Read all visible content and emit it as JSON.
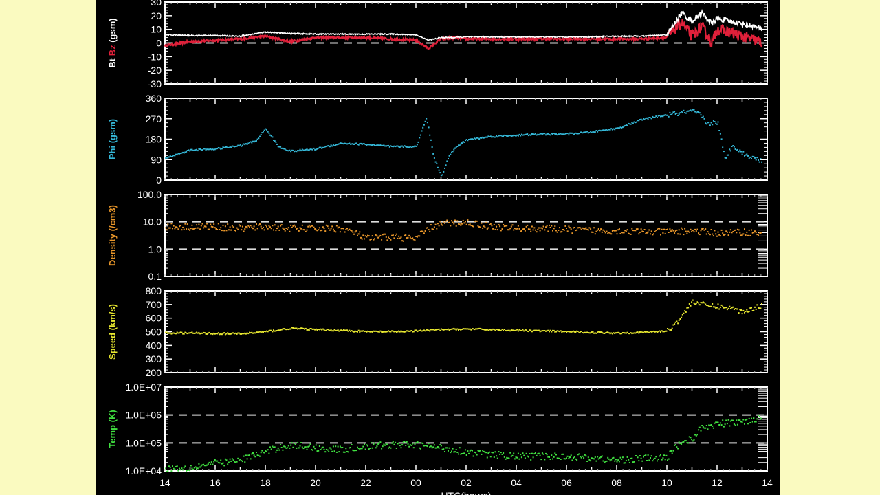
{
  "colors": {
    "page_bg": "#fafac0",
    "panel_bg": "#000000",
    "bt": "#ffffff",
    "bz": "#e0203a",
    "phi": "#35b8d8",
    "density": "#e8962a",
    "speed": "#e8e830",
    "temp": "#40e040"
  },
  "chart_data": [
    {
      "type": "line",
      "ylabel_parts": [
        "Bt",
        "Bz",
        "(gsm)"
      ],
      "ylim": [
        -30,
        30
      ],
      "yticks": [
        "-30",
        "-20",
        "-10",
        "0",
        "10",
        "20",
        "30"
      ],
      "reference_line": 0,
      "x": [
        14,
        15,
        16,
        17,
        18,
        19,
        20,
        21,
        22,
        23,
        24,
        24.5,
        25,
        25.5,
        26,
        27,
        28,
        29,
        30,
        31,
        32,
        33,
        34,
        34.3,
        34.6,
        35,
        35.4,
        35.8,
        36,
        36.5,
        37,
        37.5,
        37.8
      ],
      "series": [
        {
          "name": "Bt",
          "values": [
            6,
            5.5,
            5.5,
            5,
            8,
            7,
            6.5,
            6.5,
            6.5,
            6.5,
            6,
            2,
            4,
            4,
            4.5,
            4.5,
            4.5,
            4.5,
            4.5,
            4.5,
            5,
            5,
            6,
            14,
            22,
            16,
            22,
            14,
            18,
            16,
            14,
            12,
            10
          ]
        },
        {
          "name": "Bz",
          "values": [
            -2,
            1,
            2,
            3,
            5,
            1,
            4,
            4,
            4,
            3,
            2,
            -4,
            3,
            4,
            3,
            3,
            3,
            3,
            3,
            3,
            3,
            3,
            4,
            10,
            15,
            5,
            12,
            0,
            10,
            8,
            5,
            2,
            0
          ]
        }
      ]
    },
    {
      "type": "scatter",
      "ylabel": "Phi (gsm)",
      "ylim": [
        0,
        360
      ],
      "yticks": [
        "0",
        "90",
        "180",
        "270",
        "360"
      ],
      "x": [
        14,
        15,
        16,
        17,
        17.6,
        18,
        18.5,
        19,
        20,
        21,
        22,
        23,
        24,
        24.4,
        24.7,
        25,
        25.3,
        25.6,
        26,
        27,
        28,
        29,
        30,
        31,
        32,
        33,
        34,
        35,
        35.3,
        35.6,
        36,
        36.3,
        36.6,
        37,
        37.4,
        37.8
      ],
      "series": [
        {
          "name": "Phi",
          "values": [
            100,
            135,
            140,
            155,
            175,
            230,
            150,
            130,
            140,
            165,
            160,
            150,
            150,
            280,
            100,
            20,
            110,
            150,
            180,
            195,
            200,
            205,
            205,
            215,
            230,
            270,
            290,
            305,
            290,
            250,
            260,
            90,
            160,
            120,
            100,
            90
          ]
        }
      ]
    },
    {
      "type": "scatter",
      "ylabel": "Density (/cm3)",
      "yscale": "log",
      "ylim": [
        0.1,
        100
      ],
      "yticks": [
        "0.1",
        "1.0",
        "10.0",
        "100.0"
      ],
      "reference_lines": [
        1,
        10
      ],
      "x": [
        14,
        15,
        16,
        17,
        18,
        19,
        20,
        21,
        22,
        23,
        24,
        25,
        26,
        27,
        28,
        29,
        30,
        31,
        32,
        33,
        34,
        35,
        36,
        37,
        37.8
      ],
      "series": [
        {
          "name": "Density",
          "values": [
            7,
            7,
            7,
            6,
            7,
            6,
            6,
            6,
            2.5,
            3,
            2.5,
            9,
            10,
            7,
            6,
            6,
            5.5,
            5,
            5,
            4.5,
            4.5,
            5,
            4,
            4.5,
            4
          ]
        }
      ]
    },
    {
      "type": "scatter",
      "ylabel": "Speed (km/s)",
      "ylim": [
        200,
        800
      ],
      "yticks": [
        "200",
        "300",
        "400",
        "500",
        "600",
        "700",
        "800"
      ],
      "x": [
        14,
        15,
        16,
        17,
        18,
        19,
        20,
        21,
        22,
        23,
        24,
        25,
        26,
        27,
        28,
        29,
        30,
        31,
        32,
        33,
        34,
        34.5,
        35,
        35.5,
        36,
        36.5,
        37,
        37.8
      ],
      "series": [
        {
          "name": "Speed",
          "values": [
            495,
            495,
            492,
            490,
            505,
            530,
            520,
            515,
            505,
            505,
            510,
            520,
            525,
            520,
            515,
            510,
            505,
            500,
            495,
            500,
            510,
            600,
            730,
            700,
            690,
            680,
            650,
            700
          ]
        }
      ]
    },
    {
      "type": "scatter",
      "ylabel": "Temp (K)",
      "yscale": "log",
      "ylim": [
        10000,
        10000000
      ],
      "yticks": [
        "1.0E+04",
        "1.0E+05",
        "1.0E+06",
        "1.0E+07"
      ],
      "reference_lines": [
        100000,
        1000000
      ],
      "x": [
        14,
        15,
        16,
        17,
        18,
        19,
        20,
        21,
        22,
        23,
        24,
        25,
        26,
        27,
        28,
        29,
        30,
        31,
        32,
        33,
        34,
        34.5,
        35,
        35.5,
        36,
        37,
        37.8
      ],
      "series": [
        {
          "name": "Temp",
          "values": [
            13000,
            14000,
            20000,
            25000,
            50000,
            90000,
            70000,
            60000,
            80000,
            90000,
            90000,
            70000,
            50000,
            40000,
            35000,
            35000,
            35000,
            30000,
            25000,
            30000,
            30000,
            100000,
            150000,
            400000,
            500000,
            600000,
            900000
          ]
        }
      ]
    },
    {
      "type": "axis",
      "xlabel": "UTC(hours)",
      "xlim": [
        14,
        38
      ],
      "xticks": [
        "14",
        "16",
        "18",
        "20",
        "22",
        "00",
        "02",
        "04",
        "06",
        "08",
        "10",
        "12",
        "14"
      ]
    }
  ]
}
